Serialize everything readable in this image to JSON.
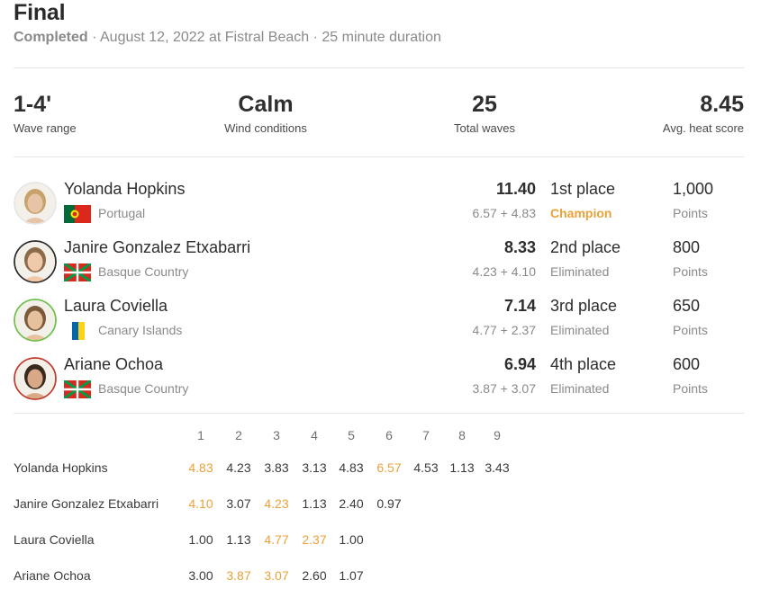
{
  "heat": {
    "title": "Final",
    "status": "Completed",
    "details": " · August 12, 2022 at Fistral Beach · 25 minute duration"
  },
  "stats": [
    {
      "value": "1-4'",
      "label": "Wave range"
    },
    {
      "value": "Calm",
      "label": "Wind conditions"
    },
    {
      "value": "25",
      "label": "Total waves"
    },
    {
      "value": "8.45",
      "label": "Avg. heat score"
    }
  ],
  "surfers": [
    {
      "name": "Yolanda Hopkins",
      "country": "Portugal",
      "flag": "portugal-flag",
      "total": "11.40",
      "breakdown": "6.57 + 4.83",
      "place": "1st place",
      "result": "Champion",
      "champion": true,
      "points": "1,000",
      "points_label": "Points",
      "avatar_ring": "#e6e6e6"
    },
    {
      "name": "Janire Gonzalez Etxabarri",
      "country": "Basque Country",
      "flag": "basque-flag",
      "total": "8.33",
      "breakdown": "4.23 + 4.10",
      "place": "2nd place",
      "result": "Eliminated",
      "champion": false,
      "points": "800",
      "points_label": "Points",
      "avatar_ring": "#2a2a2a"
    },
    {
      "name": "Laura Coviella",
      "country": "Canary Islands",
      "flag": "canary-islands-flag",
      "total": "7.14",
      "breakdown": "4.77 + 2.37",
      "place": "3rd place",
      "result": "Eliminated",
      "champion": false,
      "points": "650",
      "points_label": "Points",
      "avatar_ring": "#6cc04a"
    },
    {
      "name": "Ariane Ochoa",
      "country": "Basque Country",
      "flag": "basque-flag",
      "total": "6.94",
      "breakdown": "3.87 + 3.07",
      "place": "4th place",
      "result": "Eliminated",
      "champion": false,
      "points": "600",
      "points_label": "Points",
      "avatar_ring": "#c0392b"
    }
  ],
  "waves": {
    "headers": [
      "1",
      "2",
      "3",
      "4",
      "5",
      "6",
      "7",
      "8",
      "9"
    ],
    "rows": [
      {
        "name": "Yolanda Hopkins",
        "scores": [
          "4.83",
          "4.23",
          "3.83",
          "3.13",
          "4.83",
          "6.57",
          "4.53",
          "1.13",
          "3.43"
        ],
        "counting": [
          0,
          5
        ]
      },
      {
        "name": "Janire Gonzalez Etxabarri",
        "scores": [
          "4.10",
          "3.07",
          "4.23",
          "1.13",
          "2.40",
          "0.97"
        ],
        "counting": [
          0,
          2
        ]
      },
      {
        "name": "Laura Coviella",
        "scores": [
          "1.00",
          "1.13",
          "4.77",
          "2.37",
          "1.00"
        ],
        "counting": [
          2,
          3
        ]
      },
      {
        "name": "Ariane Ochoa",
        "scores": [
          "3.00",
          "3.87",
          "3.07",
          "2.60",
          "1.07"
        ],
        "counting": [
          1,
          2
        ]
      }
    ]
  },
  "colors": {
    "accent": "#e9a23b",
    "muted": "#8a8a8a",
    "text": "#2d2d2d"
  }
}
